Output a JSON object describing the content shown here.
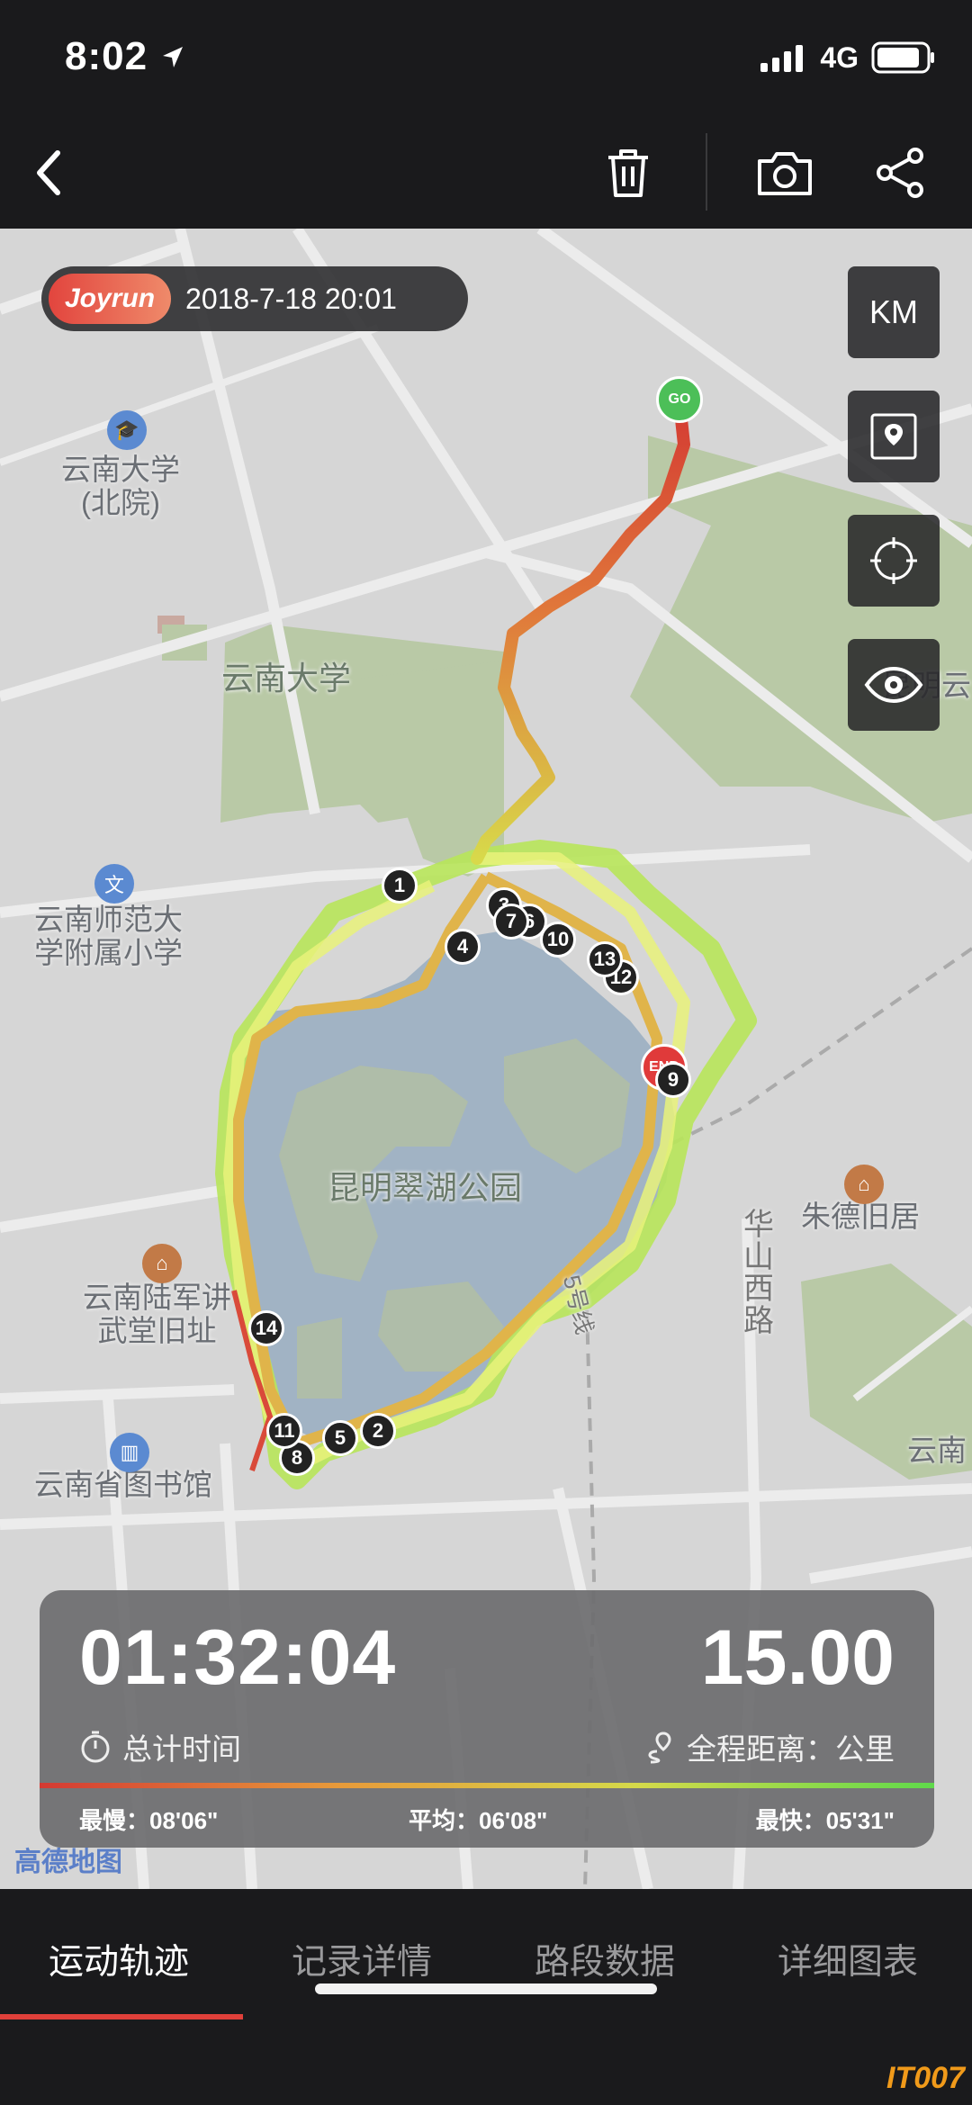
{
  "status": {
    "time": "8:02",
    "network": "4G"
  },
  "map": {
    "brand": "Joyrun",
    "datetime": "2018-7-18 20:01",
    "unit_button": "KM",
    "labels": {
      "yunnan_univ_north": "云南大学\n(北院)",
      "yunnan_univ": "云南大学",
      "normal_school": "云南师范大\n学附属小学",
      "lake_park": "昆明翠湖公园",
      "huashan_road": "华\n山\n西\n路",
      "zhude": "朱德旧居",
      "military_school": "云南陆军讲\n武堂旧址",
      "library": "云南省图书馆",
      "yunnan_right": "云南",
      "kunming_right": "昆明云",
      "line5": "5号线"
    },
    "markers": [
      "1",
      "2",
      "3",
      "4",
      "5",
      "6",
      "7",
      "8",
      "9",
      "10",
      "11",
      "12",
      "13",
      "14"
    ],
    "start_pin": "GO",
    "end_pin": "END",
    "attribution": "高德地图"
  },
  "stats": {
    "duration": "01:32:04",
    "duration_label": "总计时间",
    "distance": "15.00",
    "distance_label": "全程距离：公里",
    "slowest": "最慢：08'06\"",
    "average": "平均：06'08\"",
    "fastest": "最快：05'31\""
  },
  "tabs": [
    "运动轨迹",
    "记录详情",
    "路段数据",
    "详细图表"
  ],
  "watermark": "IT007"
}
